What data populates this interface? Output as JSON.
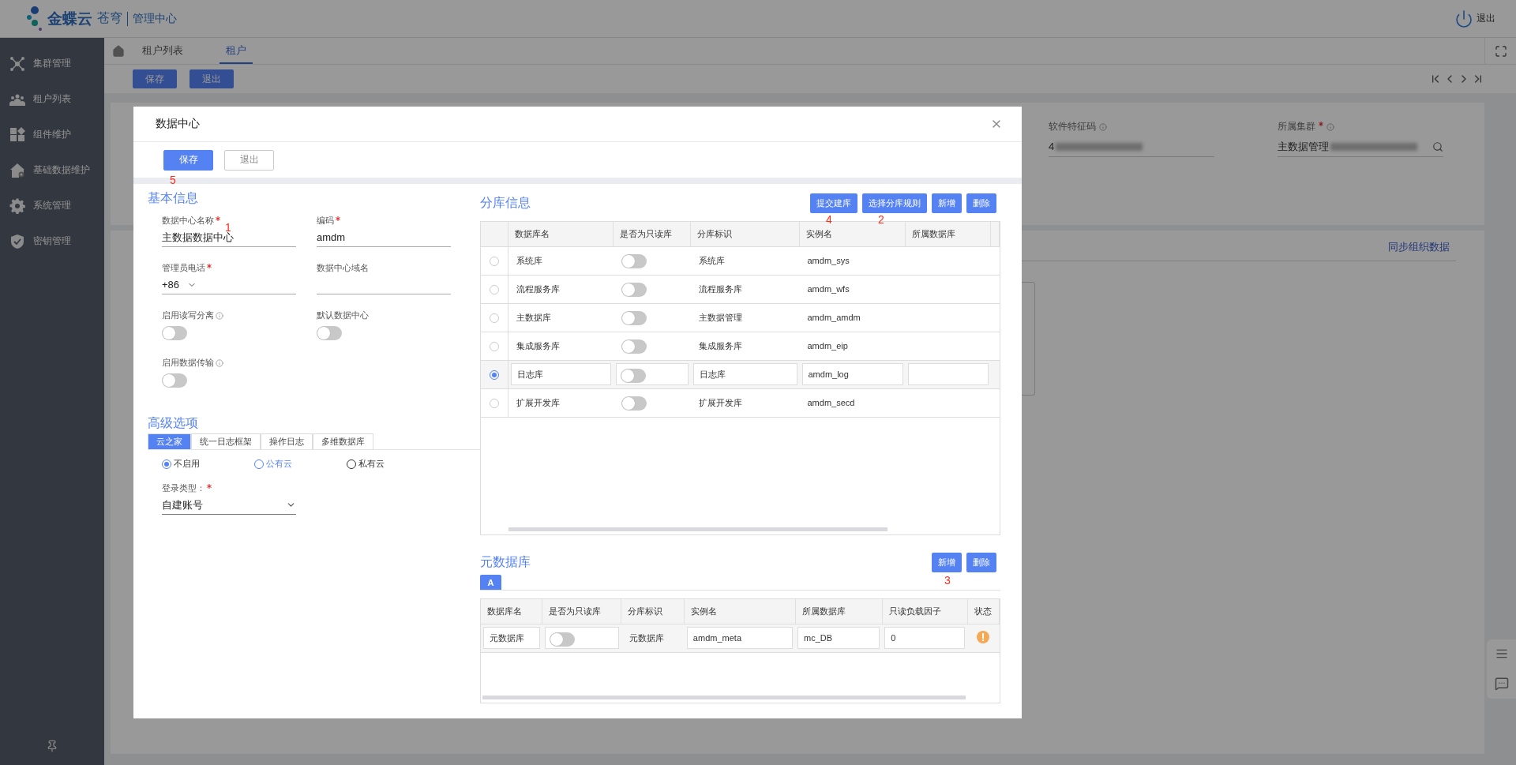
{
  "header": {
    "brand": "金蝶云",
    "product": "苍穹",
    "section": "管理中心",
    "logout": "退出"
  },
  "sidebar": {
    "items": [
      {
        "label": "集群管理",
        "kind": "cluster"
      },
      {
        "label": "租户列表",
        "kind": "tenants"
      },
      {
        "label": "组件维护",
        "kind": "components"
      },
      {
        "label": "基础数据维护",
        "kind": "basedata"
      },
      {
        "label": "系统管理",
        "kind": "settings"
      },
      {
        "label": "密钥管理",
        "kind": "shield"
      }
    ]
  },
  "tabs": [
    {
      "label": "租户列表",
      "selected": false
    },
    {
      "label": "租户",
      "selected": true
    }
  ],
  "toolbar": {
    "buttons": [
      "保存",
      "退出"
    ]
  },
  "tenant_form": {
    "fields": [
      {
        "label": "软件特征码",
        "value": "4",
        "required": false,
        "info": true,
        "kind": "text"
      },
      {
        "label": "所属集群",
        "value": "主数据管理",
        "required": true,
        "info": true,
        "kind": "lookup"
      }
    ]
  },
  "org_section": {
    "link": "同步组织数据"
  },
  "dialog": {
    "title": "数据中心",
    "buttons": [
      {
        "label": "保存",
        "kind": "primary",
        "annotation": "5"
      },
      {
        "label": "退出",
        "kind": "secondary"
      }
    ],
    "basic": {
      "title": "基本信息",
      "fields": [
        {
          "label": "数据中心名称",
          "kind": "text",
          "required": true,
          "value": "主数据数据中心",
          "annotation": "1"
        },
        {
          "label": "编码",
          "kind": "text",
          "required": true,
          "value": "amdm"
        },
        {
          "label": "管理员电话",
          "kind": "phone",
          "required": true,
          "value": "+86"
        },
        {
          "label": "数据中心域名",
          "kind": "text",
          "required": false
        },
        {
          "label": "启用读写分离",
          "kind": "switch",
          "info": true,
          "on": false
        },
        {
          "label": "默认数据中心",
          "kind": "switch",
          "on": false
        },
        {
          "label": "启用数据传输",
          "kind": "switch",
          "info": true,
          "on": false
        }
      ]
    },
    "advanced": {
      "title": "高级选项",
      "tabs": [
        {
          "label": "云之家",
          "selected": true
        },
        {
          "label": "统一日志框架",
          "selected": false
        },
        {
          "label": "操作日志",
          "selected": false
        },
        {
          "label": "多维数据库",
          "selected": false
        }
      ],
      "radios": [
        {
          "label": "不启用",
          "selected": true,
          "hovered": false
        },
        {
          "label": "公有云",
          "selected": false,
          "hovered": true
        },
        {
          "label": "私有云",
          "selected": false,
          "hovered": false
        }
      ],
      "login_type": {
        "label": "登录类型：",
        "required": true,
        "value": "自建账号"
      }
    },
    "shards": {
      "title": "分库信息",
      "buttons": [
        {
          "label": "提交建库",
          "annotation": "4"
        },
        {
          "label": "选择分库规则",
          "annotation": "2"
        },
        {
          "label": "新增"
        },
        {
          "label": "删除"
        }
      ],
      "columns": [
        "数据库名",
        "是否为只读库",
        "分库标识",
        "实例名",
        "所属数据库"
      ],
      "rows": [
        {
          "selected": false,
          "name": "系统库",
          "readonly": false,
          "tag": "系统库",
          "instance": "amdm_sys"
        },
        {
          "selected": false,
          "name": "流程服务库",
          "readonly": false,
          "tag": "流程服务库",
          "instance": "amdm_wfs"
        },
        {
          "selected": false,
          "name": "主数据库",
          "readonly": false,
          "tag": "主数据管理",
          "instance": "amdm_amdm"
        },
        {
          "selected": false,
          "name": "集成服务库",
          "readonly": false,
          "tag": "集成服务库",
          "instance": "amdm_eip"
        },
        {
          "selected": true,
          "name": "日志库",
          "readonly": false,
          "tag": "日志库",
          "instance": "amdm_log"
        },
        {
          "selected": false,
          "name": "扩展开发库",
          "readonly": false,
          "tag": "扩展开发库",
          "instance": "amdm_secd"
        }
      ]
    },
    "meta": {
      "title": "元数据库",
      "buttons": [
        {
          "label": "新增",
          "annotation": "3"
        },
        {
          "label": "删除"
        }
      ],
      "tabs": [
        {
          "label": "A",
          "selected": true
        }
      ],
      "columns": [
        "数据库名",
        "是否为只读库",
        "分库标识",
        "实例名",
        "所属数据库",
        "只读负载因子",
        "状态"
      ],
      "rows": [
        {
          "name": "元数据库",
          "readonly": false,
          "tag": "元数据库",
          "instance": "amdm_meta",
          "database": "mc_DB",
          "factor": "0",
          "kind": "warning"
        }
      ]
    }
  }
}
